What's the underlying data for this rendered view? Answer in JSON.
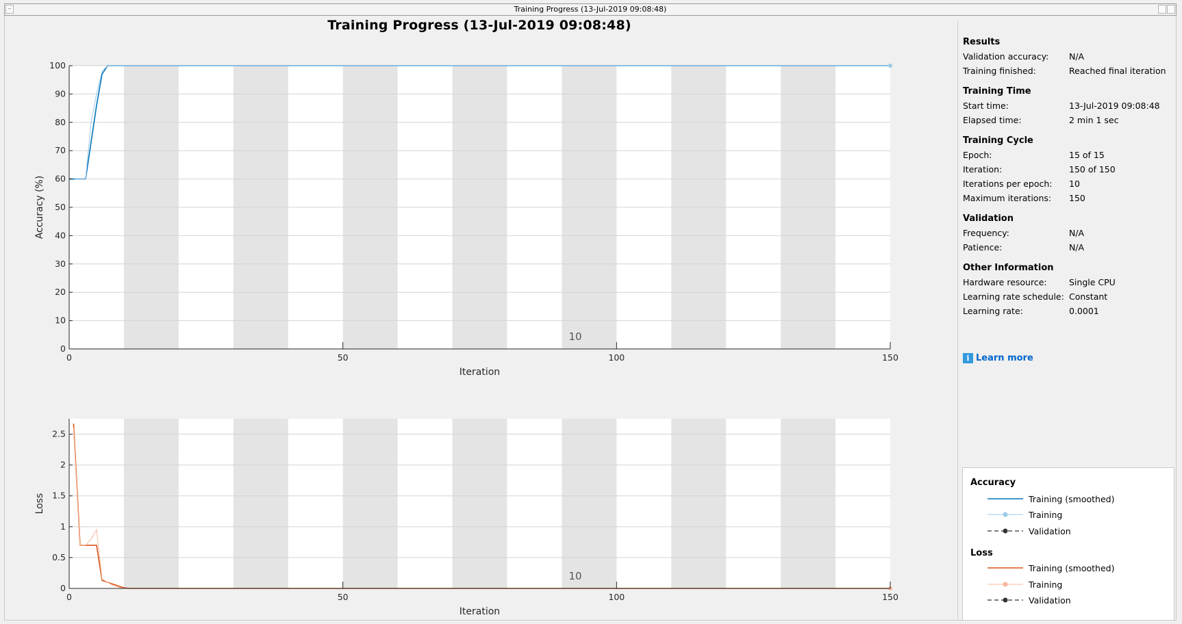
{
  "window": {
    "title": "Training Progress (13-Jul-2019 09:08:48)"
  },
  "main_title": "Training Progress (13-Jul-2019 09:08:48)",
  "chart_data": [
    {
      "type": "line",
      "name": "accuracy-plot",
      "ylabel": "Accuracy (%)",
      "xlabel": "Iteration",
      "xlim": [
        0,
        150
      ],
      "ylim": [
        0,
        100
      ],
      "xticks": [
        0,
        50,
        100,
        150
      ],
      "yticks": [
        0,
        10,
        20,
        30,
        40,
        50,
        60,
        70,
        80,
        90,
        100
      ],
      "epoch_label": "10",
      "series": [
        {
          "name": "Training (smoothed)",
          "color": "#0072bd",
          "x": [
            0,
            1,
            2,
            3,
            4,
            5,
            6,
            7,
            150
          ],
          "y": [
            60,
            60,
            60,
            60,
            73,
            86,
            97,
            100,
            100
          ]
        },
        {
          "name": "Training",
          "color": "#9ecae8",
          "x": [
            1,
            2,
            3,
            4,
            5,
            6,
            7,
            150
          ],
          "y": [
            60,
            60,
            60,
            80,
            90,
            98,
            100,
            100
          ]
        }
      ]
    },
    {
      "type": "line",
      "name": "loss-plot",
      "ylabel": "Loss",
      "xlabel": "Iteration",
      "xlim": [
        0,
        150
      ],
      "ylim": [
        0,
        2.75
      ],
      "xticks": [
        0,
        50,
        100,
        150
      ],
      "yticks": [
        0,
        0.5,
        1,
        1.5,
        2,
        2.5
      ],
      "epoch_label": "10",
      "series": [
        {
          "name": "Training (smoothed)",
          "color": "#d95319",
          "x": [
            0.8,
            2,
            3,
            4,
            5,
            6,
            7,
            8,
            9,
            10,
            11,
            150
          ],
          "y": [
            2.67,
            0.7,
            0.7,
            0.7,
            0.7,
            0.13,
            0.1,
            0.07,
            0.04,
            0.01,
            0.0,
            0.0
          ]
        },
        {
          "name": "Training",
          "color": "#f4b79a",
          "x": [
            0.8,
            2,
            3,
            4,
            5,
            6,
            7,
            8,
            9,
            10,
            150
          ],
          "y": [
            2.6,
            0.7,
            0.7,
            0.8,
            0.95,
            0.15,
            0.1,
            0.05,
            0.02,
            0.0,
            0.0
          ]
        }
      ]
    }
  ],
  "epochs": {
    "count": 15,
    "iterations_per_epoch": 10
  },
  "info": {
    "sections": [
      {
        "heading": "Results",
        "rows": [
          {
            "k": "Validation accuracy:",
            "v": "N/A"
          },
          {
            "k": "Training finished:",
            "v": "Reached final iteration"
          }
        ]
      },
      {
        "heading": "Training Time",
        "rows": [
          {
            "k": "Start time:",
            "v": "13-Jul-2019 09:08:48"
          },
          {
            "k": "Elapsed time:",
            "v": "2 min 1 sec"
          }
        ]
      },
      {
        "heading": "Training Cycle",
        "rows": [
          {
            "k": "Epoch:",
            "v": "15 of 15"
          },
          {
            "k": "Iteration:",
            "v": "150 of 150"
          },
          {
            "k": "Iterations per epoch:",
            "v": "10"
          },
          {
            "k": "Maximum iterations:",
            "v": "150"
          }
        ]
      },
      {
        "heading": "Validation",
        "rows": [
          {
            "k": "Frequency:",
            "v": "N/A"
          },
          {
            "k": "Patience:",
            "v": "N/A"
          }
        ]
      },
      {
        "heading": "Other Information",
        "rows": [
          {
            "k": "Hardware resource:",
            "v": "Single CPU"
          },
          {
            "k": "Learning rate schedule:",
            "v": "Constant"
          },
          {
            "k": "Learning rate:",
            "v": "0.0001"
          }
        ]
      }
    ],
    "learn_more": "Learn more"
  },
  "legend": {
    "accuracy": {
      "heading": "Accuracy",
      "smoothed": "Training (smoothed)",
      "training": "Training",
      "validation": "Validation"
    },
    "loss": {
      "heading": "Loss",
      "smoothed": "Training (smoothed)",
      "training": "Training",
      "validation": "Validation"
    },
    "colors": {
      "acc_smoothed": "#0072bd",
      "acc_training": "#9ecae8",
      "loss_smoothed": "#d95319",
      "loss_training": "#f4b79a",
      "validation": "#333333"
    }
  }
}
